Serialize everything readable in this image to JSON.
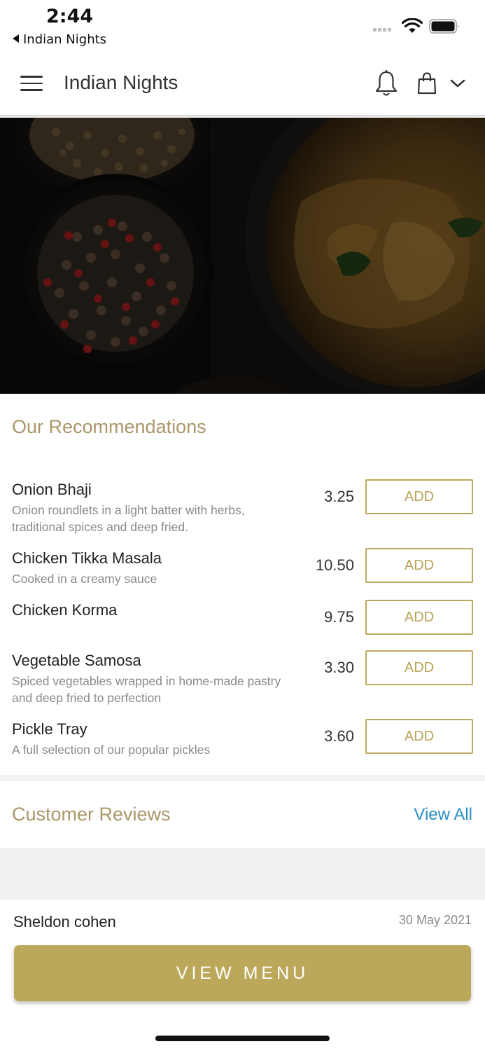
{
  "status_bar": {
    "time": "2:44",
    "back_app": "Indian Nights"
  },
  "header": {
    "title": "Indian Nights",
    "icons": [
      "menu-icon",
      "bell-icon",
      "shopping-bag-icon",
      "chevron-down-icon"
    ]
  },
  "recommendations": {
    "title": "Our Recommendations",
    "add_label": "ADD",
    "items": [
      {
        "name": "Onion Bhaji",
        "description": "Onion roundlets in a light batter with herbs, traditional spices and deep fried.",
        "price": "3.25"
      },
      {
        "name": "Chicken Tikka Masala",
        "description": "Cooked in a creamy sauce",
        "price": "10.50"
      },
      {
        "name": "Chicken Korma",
        "description": "",
        "price": "9.75"
      },
      {
        "name": "Vegetable Samosa",
        "description": "Spiced vegetables wrapped in home-made pastry and deep fried to perfection",
        "price": "3.30"
      },
      {
        "name": "Pickle Tray",
        "description": "A full selection of our popular pickles",
        "price": "3.60"
      }
    ]
  },
  "reviews": {
    "title": "Customer Reviews",
    "view_all": "View All",
    "items": [
      {
        "author": "Sheldon cohen",
        "date": "30 May 2021"
      }
    ]
  },
  "cta": {
    "label": "VIEW MENU"
  },
  "colors": {
    "accent_gold": "#bba85a",
    "section_title": "#ab9669",
    "link_blue": "#2a8fc5"
  }
}
